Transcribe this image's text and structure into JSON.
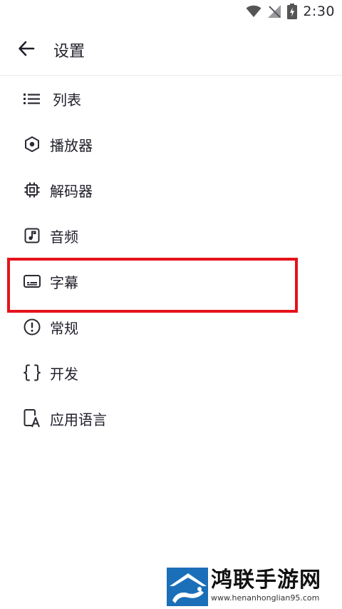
{
  "status_bar": {
    "time": "2:30"
  },
  "app_bar": {
    "title": "设置"
  },
  "menu": {
    "items": [
      {
        "label": "列表",
        "icon": "list-icon"
      },
      {
        "label": "播放器",
        "icon": "hexagon-dot-icon"
      },
      {
        "label": "解码器",
        "icon": "chip-icon"
      },
      {
        "label": "音频",
        "icon": "music-note-icon"
      },
      {
        "label": "字幕",
        "icon": "subtitles-icon"
      },
      {
        "label": "常规",
        "icon": "alert-circle-icon"
      },
      {
        "label": "开发",
        "icon": "code-braces-icon"
      },
      {
        "label": "应用语言",
        "icon": "phone-language-icon"
      }
    ],
    "highlighted": "字幕"
  },
  "watermark": {
    "title": "鸿联手游网",
    "url": "www.henanhonglian95.com"
  },
  "colors": {
    "highlight": "#e4131b",
    "text": "#1f1f2b",
    "watermark_blue": "#1a6fb8"
  }
}
